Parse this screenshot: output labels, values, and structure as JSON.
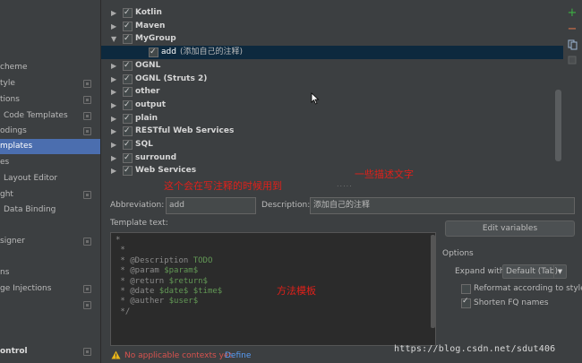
{
  "sidebar": {
    "items": [
      {
        "label": "cheme",
        "gear": false,
        "selected": false,
        "bold": false
      },
      {
        "label": "tyle",
        "gear": true,
        "selected": false,
        "bold": false
      },
      {
        "label": "tions",
        "gear": true,
        "selected": false,
        "bold": false
      },
      {
        "label": "Code Templates",
        "gear": true,
        "selected": false,
        "bold": false
      },
      {
        "label": "odings",
        "gear": true,
        "selected": false,
        "bold": false
      },
      {
        "label": "mplates",
        "gear": false,
        "selected": true,
        "bold": false
      },
      {
        "label": "es",
        "gear": false,
        "selected": false,
        "bold": false
      },
      {
        "label": "Layout Editor",
        "gear": false,
        "selected": false,
        "bold": false
      },
      {
        "label": "ght",
        "gear": true,
        "selected": false,
        "bold": false
      },
      {
        "label": "Data Binding",
        "gear": false,
        "selected": false,
        "bold": false
      },
      {
        "label": "signer",
        "gear": true,
        "selected": false,
        "bold": false
      },
      {
        "label": "ns",
        "gear": false,
        "selected": false,
        "bold": false
      },
      {
        "label": "ge Injections",
        "gear": true,
        "selected": false,
        "bold": false
      },
      {
        "label": "",
        "gear": true,
        "selected": false,
        "bold": false
      },
      {
        "label": "ontrol",
        "gear": true,
        "selected": false,
        "bold": true
      }
    ]
  },
  "tree": {
    "rows": [
      {
        "name": "Kotlin",
        "expanded": false
      },
      {
        "name": "Maven",
        "expanded": false
      },
      {
        "name": "MyGroup",
        "expanded": true
      },
      {
        "name": "add",
        "desc": "(添加自己的注释)",
        "child": true
      },
      {
        "name": "OGNL",
        "expanded": false
      },
      {
        "name": "OGNL (Struts 2)",
        "expanded": false
      },
      {
        "name": "other",
        "expanded": false
      },
      {
        "name": "output",
        "expanded": false
      },
      {
        "name": "plain",
        "expanded": false
      },
      {
        "name": "RESTful Web Services",
        "expanded": false
      },
      {
        "name": "SQL",
        "expanded": false
      },
      {
        "name": "surround",
        "expanded": false
      },
      {
        "name": "Web Services",
        "expanded": false
      }
    ]
  },
  "toolbar": {
    "add_icon": "+",
    "remove_icon": "−"
  },
  "annotations": {
    "abbrev_note": "这个会在写注释的时候用到",
    "desc_note": "一些描述文字",
    "template_note": "方法模板"
  },
  "form": {
    "abbreviation_label": "Abbreviation:",
    "abbreviation_value": "add",
    "description_label": "Description:",
    "description_value": "添加自己的注释",
    "template_text_label": "Template text:"
  },
  "template_lines": [
    {
      "pre": "*",
      "tag": "",
      "rest": ""
    },
    {
      "pre": " *",
      "tag": "",
      "rest": ""
    },
    {
      "pre": " * ",
      "tag": "@Description",
      "rest": " TODO"
    },
    {
      "pre": " * ",
      "tag": "@param",
      "rest": " $param$"
    },
    {
      "pre": " * ",
      "tag": "@return",
      "rest": " $return$"
    },
    {
      "pre": " * ",
      "tag": "@date",
      "rest": " $date$ $time$"
    },
    {
      "pre": " * ",
      "tag": "@auther",
      "rest": " $user$"
    },
    {
      "pre": " */",
      "tag": "",
      "rest": ""
    }
  ],
  "options": {
    "edit_variables": "Edit variables",
    "title": "Options",
    "expand_with_label": "Expand with",
    "expand_with_value": "Default (Tab)",
    "reformat_label": "Reformat according to style",
    "reformat_checked": false,
    "shorten_label": "Shorten FQ names",
    "shorten_checked": true
  },
  "status": {
    "warning_icon": "warning-icon",
    "message": "No applicable contexts yet.",
    "link": "Define"
  },
  "watermark": "https://blog.csdn.net/sdut406",
  "colors": {
    "accent": "#4b6eaf",
    "annotation": "#e0201a",
    "add": "#3cb043",
    "remove": "#d9734b"
  }
}
